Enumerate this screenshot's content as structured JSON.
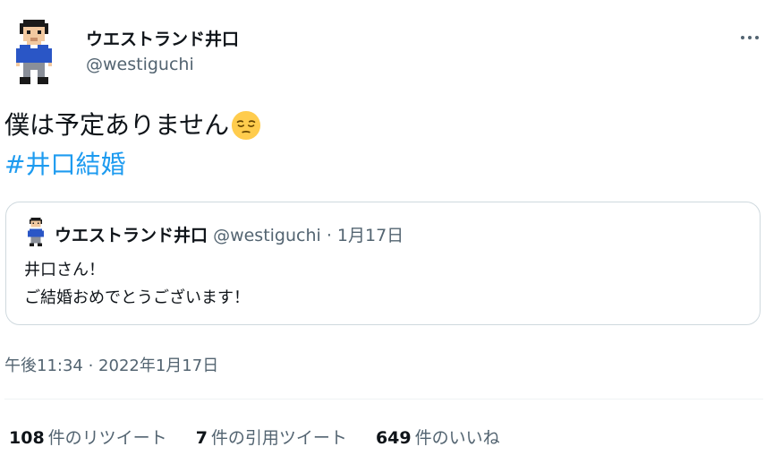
{
  "author": {
    "display_name": "ウエストランド井口",
    "handle": "@westiguchi",
    "avatar_icon": "pixel-man-avatar-icon"
  },
  "menu_icon": "more-horizontal-icon",
  "tweet": {
    "text_line1": "僕は予定ありません",
    "emoji": "pensive-face-emoji",
    "hashtag": "#井口結婚"
  },
  "quote": {
    "display_name": "ウエストランド井口",
    "meta": "@westiguchi · 1月17日",
    "line1": "井口さん！",
    "line2": "ご結婚おめでとうございます！"
  },
  "timestamp": "午後11:34 · 2022年1月17日",
  "stats": {
    "retweets_count": "108",
    "retweets_label": "件のリツイート",
    "quotes_count": "7",
    "quotes_label": "件の引用ツイート",
    "likes_count": "649",
    "likes_label": "件のいいね"
  },
  "colors": {
    "accent": "#1d9bf0",
    "secondary_text": "#536471",
    "primary_text": "#0f1419",
    "border": "#cfd9de"
  }
}
